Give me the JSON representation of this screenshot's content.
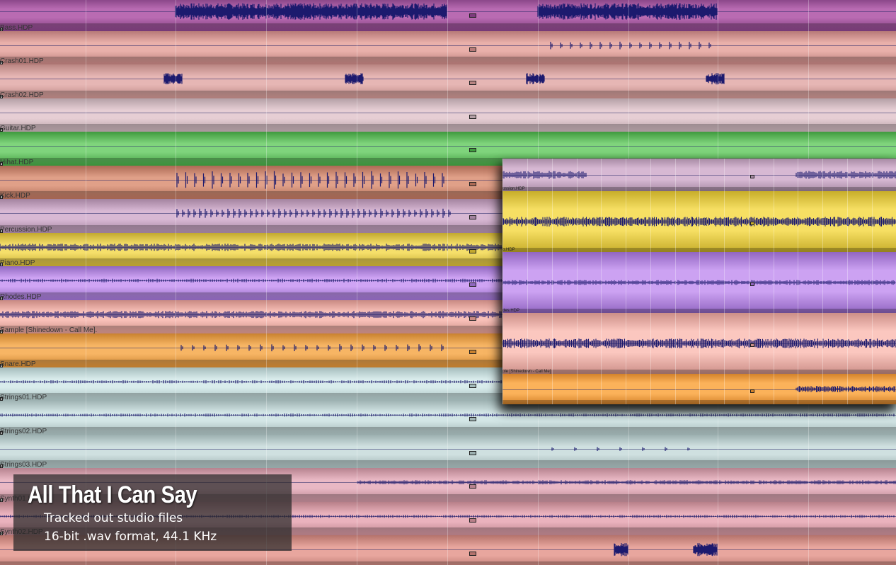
{
  "overlay": {
    "title": "All That I Can Say",
    "subtitle": "Tracked out studio files",
    "format": "16-bit .wav format, 44.1 KHz"
  },
  "tracks": [
    {
      "label": "",
      "color_top": "#b96bb2",
      "color_bottom": "#7d3c7d",
      "wave": "dense_a"
    },
    {
      "label": "Bass.HDP",
      "color_top": "#e9b0aa",
      "color_bottom": "#b77a78",
      "wave": "sparse_dots"
    },
    {
      "label": "Crash01.HDP",
      "color_top": "#e6b6b4",
      "color_bottom": "#b98582",
      "wave": "crash"
    },
    {
      "label": "Crash02.HDP",
      "color_top": "#e6ced4",
      "color_bottom": "#b4a0a6",
      "wave": "flat"
    },
    {
      "label": "Guitar.HDP",
      "color_top": "#7fd47c",
      "color_bottom": "#3f9a3e",
      "wave": "flat"
    },
    {
      "label": "Hihat.HDP",
      "color_top": "#e0a088",
      "color_bottom": "#ad6a55",
      "wave": "hits_big"
    },
    {
      "label": "Kick.HDP",
      "color_top": "#d8b8d4",
      "color_bottom": "#a3839f",
      "wave": "hits_mid"
    },
    {
      "label": "Percussion.HDP",
      "color_top": "#f5df6a",
      "color_bottom": "#c2a82f",
      "wave": "steady"
    },
    {
      "label": "Piano.HDP",
      "color_top": "#cfa4f4",
      "color_bottom": "#9068c0",
      "wave": "steady_thin"
    },
    {
      "label": "Rhodes.HDP",
      "color_top": "#f9c1b9",
      "color_bottom": "#c98a83",
      "wave": "steady"
    },
    {
      "label": "Sample [Shinedown - Call Me].",
      "color_top": "#f7b564",
      "color_bottom": "#c9822f",
      "wave": "hits_small"
    },
    {
      "label": "Snare.HDP",
      "color_top": "#d9ecec",
      "color_bottom": "#a5bcbc",
      "wave": "thin_long"
    },
    {
      "label": "Strings01.HDP",
      "color_top": "#d3e6e6",
      "color_bottom": "#a0b4b4",
      "wave": "thin_long"
    },
    {
      "label": "Strings02.HDP",
      "color_top": "#cfe0e0",
      "color_bottom": "#9cb0b0",
      "wave": "sparse_late"
    },
    {
      "label": "Strings03.HDP",
      "color_top": "#e9b8c4",
      "color_bottom": "#b6838f",
      "wave": "late_dense"
    },
    {
      "label": "Synth01.HDP",
      "color_top": "#eab2bd",
      "color_bottom": "#b88089",
      "wave": "thin_long"
    },
    {
      "label": "Synth02.HDP",
      "color_top": "#e8a69e",
      "color_bottom": "#b5736c",
      "wave": "late_hits"
    }
  ],
  "zoom_tracks": [
    {
      "label": "",
      "color_top": "#d7b8d3",
      "color_bottom": "#a78aa4",
      "wave": "z_top"
    },
    {
      "label": "ussion.HDP",
      "color_top": "#f6df63",
      "color_bottom": "#c7ad2a",
      "wave": "z_steady"
    },
    {
      "label": "o.HDP",
      "color_top": "#cca2f2",
      "color_bottom": "#9266c2",
      "wave": "z_thin"
    },
    {
      "label": "des.HDP",
      "color_top": "#fbc7bf",
      "color_bottom": "#cc8f88",
      "wave": "z_steady"
    },
    {
      "label": "ple [Shinedown - Call Me]",
      "color_top": "#fbb25a",
      "color_bottom": "#d4822a",
      "wave": "z_late"
    }
  ]
}
